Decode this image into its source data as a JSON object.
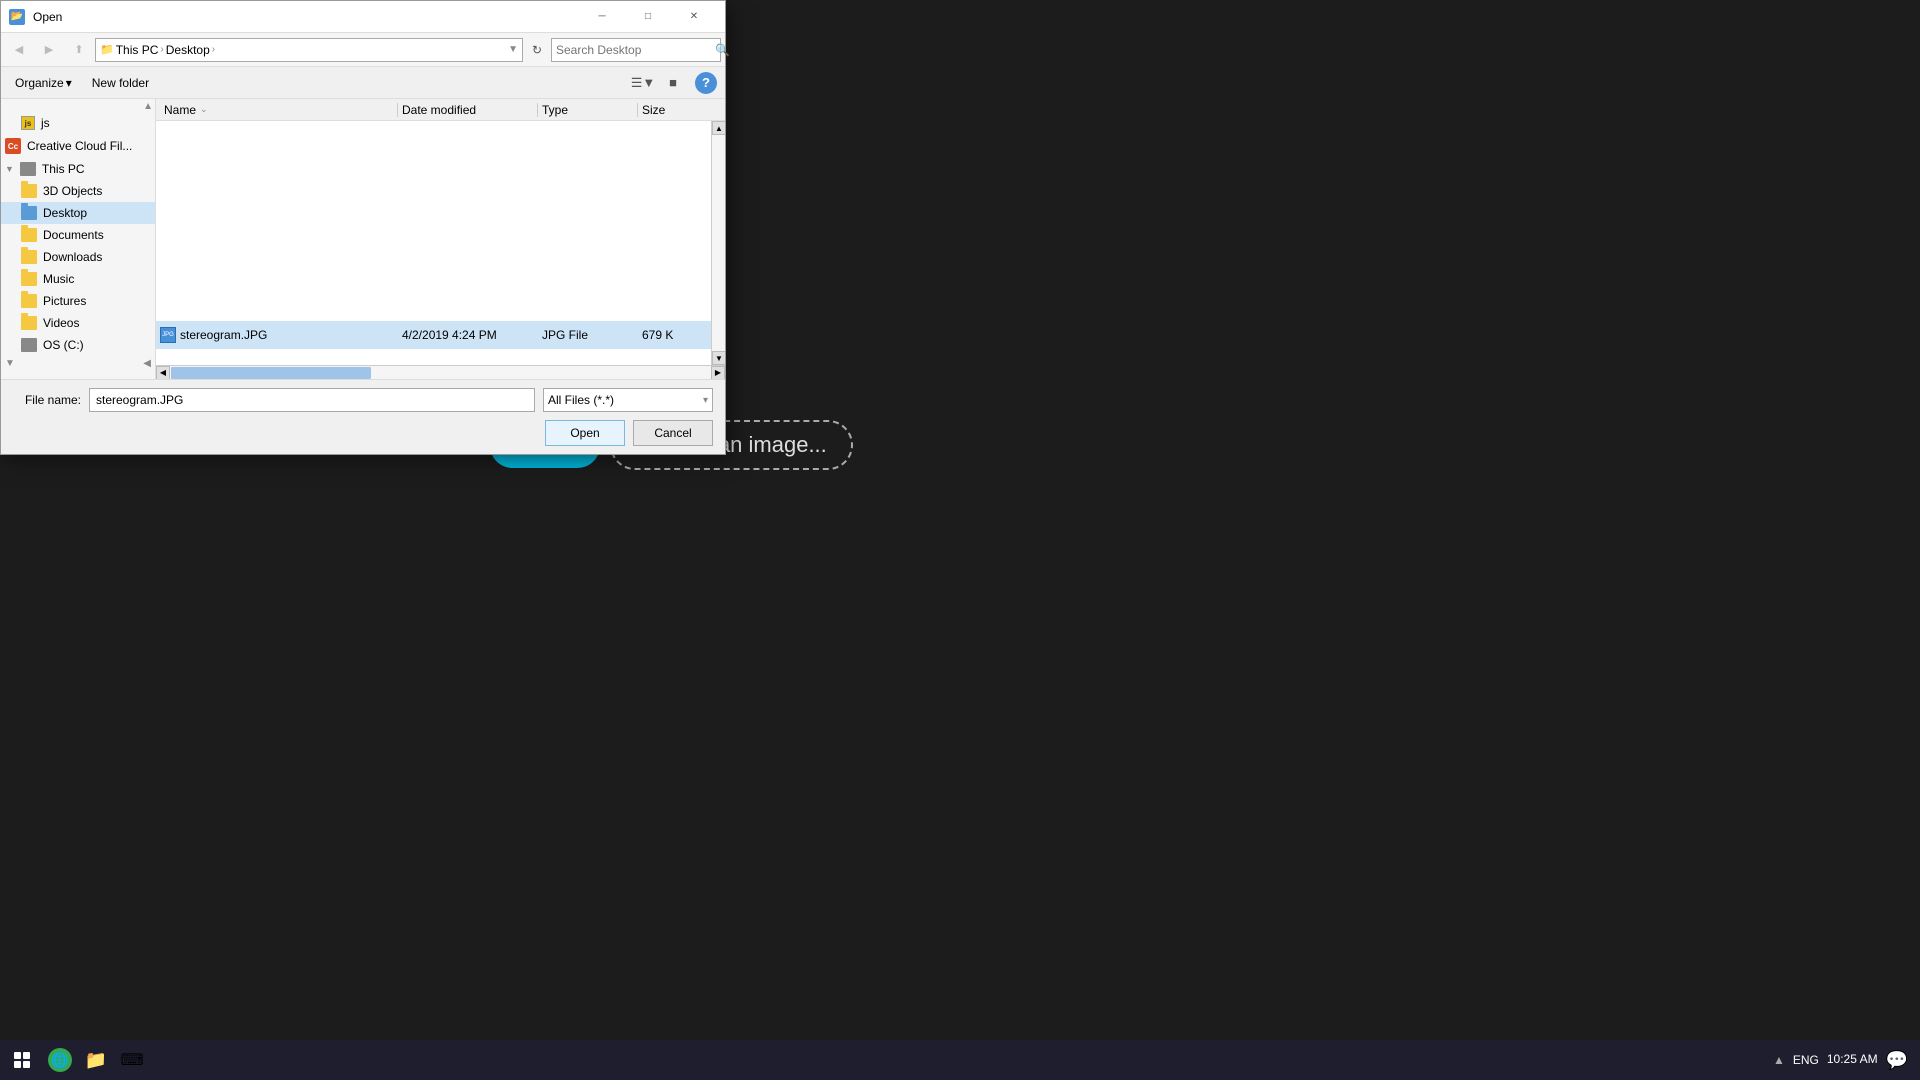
{
  "dialog": {
    "title": "Open",
    "title_icon": "📂",
    "close_label": "✕",
    "minimize_label": "─",
    "maximize_label": "□"
  },
  "toolbar": {
    "back_label": "◀",
    "forward_label": "▶",
    "up_label": "▲",
    "address": {
      "parts": [
        "This PC",
        "Desktop"
      ],
      "separator": "›"
    },
    "refresh_label": "↻",
    "search_placeholder": "Search Desktop",
    "search_icon": "🔍"
  },
  "action_bar": {
    "organize_label": "Organize",
    "organize_arrow": "▾",
    "new_folder_label": "New folder",
    "view_icon": "☰",
    "view_dropdown": "▾",
    "pane_icon": "▦",
    "help_label": "?"
  },
  "columns": {
    "name_label": "Name",
    "name_sort_arrow": "⌄",
    "date_label": "Date modified",
    "type_label": "Type",
    "size_label": "Size"
  },
  "sidebar": {
    "items": [
      {
        "id": "js",
        "label": "js",
        "type": "folder",
        "indent": 2,
        "expanded": false
      },
      {
        "id": "creative-cloud",
        "label": "Creative Cloud Fil...",
        "type": "cc",
        "indent": 0,
        "expanded": false
      },
      {
        "id": "this-pc",
        "label": "This PC",
        "type": "pc",
        "indent": 0,
        "expanded": true
      },
      {
        "id": "3d-objects",
        "label": "3D Objects",
        "type": "folder-yellow",
        "indent": 1,
        "expanded": false
      },
      {
        "id": "desktop",
        "label": "Desktop",
        "type": "folder-blue",
        "indent": 1,
        "expanded": false,
        "active": true
      },
      {
        "id": "documents",
        "label": "Documents",
        "type": "folder-yellow",
        "indent": 1,
        "expanded": false
      },
      {
        "id": "downloads",
        "label": "Downloads",
        "type": "folder-yellow",
        "indent": 1,
        "expanded": false
      },
      {
        "id": "music",
        "label": "Music",
        "type": "folder-yellow",
        "indent": 1,
        "expanded": false
      },
      {
        "id": "pictures",
        "label": "Pictures",
        "type": "folder-yellow",
        "indent": 1,
        "expanded": false
      },
      {
        "id": "videos",
        "label": "Videos",
        "type": "folder-yellow",
        "indent": 1,
        "expanded": false
      },
      {
        "id": "os-c",
        "label": "OS (C:)",
        "type": "drive",
        "indent": 1,
        "expanded": false
      }
    ]
  },
  "files": [
    {
      "name": "stereogram.JPG",
      "date": "4/2/2019 4:24 PM",
      "type": "JPG File",
      "size": "679 K",
      "selected": true
    }
  ],
  "bottom": {
    "filename_label": "File name:",
    "filename_value": "stereogram.JPG",
    "filetype_label": "All Files (*.*)",
    "open_label": "Open",
    "cancel_label": "Cancel"
  },
  "choose_image": {
    "label": "Choose an image..."
  },
  "taskbar": {
    "start_icon": "win",
    "time": "10:25 AM",
    "lang": "ENG",
    "notify_icon": "💬"
  }
}
